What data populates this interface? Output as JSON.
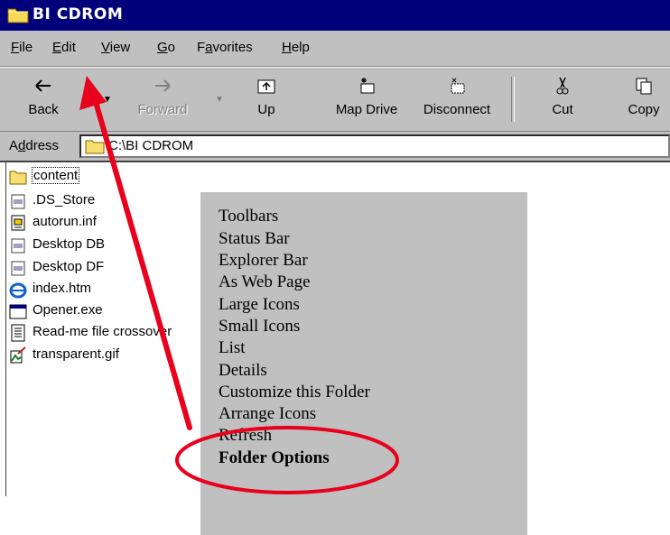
{
  "window": {
    "title": "BI CDROM"
  },
  "menubar": {
    "items": [
      {
        "label": "File",
        "mnemonic": "F",
        "rest": "ile"
      },
      {
        "label": "Edit",
        "mnemonic": "E",
        "rest": "dit"
      },
      {
        "label": "View",
        "mnemonic": "V",
        "rest": "iew"
      },
      {
        "label": "Go",
        "mnemonic": "G",
        "rest": "o"
      },
      {
        "label": "Favorites",
        "mnemonic": "a",
        "pre": "F",
        "rest": "vorites"
      },
      {
        "label": "Help",
        "mnemonic": "H",
        "rest": "elp"
      }
    ]
  },
  "toolbar": {
    "back": "Back",
    "forward": "Forward",
    "up": "Up",
    "map_drive": "Map Drive",
    "disconnect": "Disconnect",
    "cut": "Cut",
    "copy": "Copy"
  },
  "address": {
    "label_pre": "A",
    "label_mnemonic": "d",
    "label_rest": "dress",
    "value": "C:\\BI CDROM"
  },
  "files": [
    {
      "name": "content",
      "icon": "folder-icon"
    },
    {
      "name": ".DS_Store",
      "icon": "file-icon"
    },
    {
      "name": "autorun.inf",
      "icon": "settings-file-icon"
    },
    {
      "name": "Desktop DB",
      "icon": "file-icon"
    },
    {
      "name": "Desktop DF",
      "icon": "file-icon"
    },
    {
      "name": "index.htm",
      "icon": "ie-document-icon"
    },
    {
      "name": "Opener.exe",
      "icon": "application-icon"
    },
    {
      "name": "Read-me file crossover ",
      "icon": "text-document-icon"
    },
    {
      "name": "transparent.gif",
      "icon": "image-file-icon"
    }
  ],
  "view_menu": {
    "items": [
      "Toolbars",
      "Status Bar",
      "Explorer Bar",
      "As Web Page",
      "Large Icons",
      "Small Icons",
      "List",
      "Details",
      "Customize this Folder",
      "Arrange Icons",
      "Refresh",
      "Folder Options"
    ],
    "highlighted": "Folder Options"
  },
  "colors": {
    "titlebar": "#00007b",
    "chrome": "#c0c0c0",
    "annotation": "#e8001c"
  }
}
